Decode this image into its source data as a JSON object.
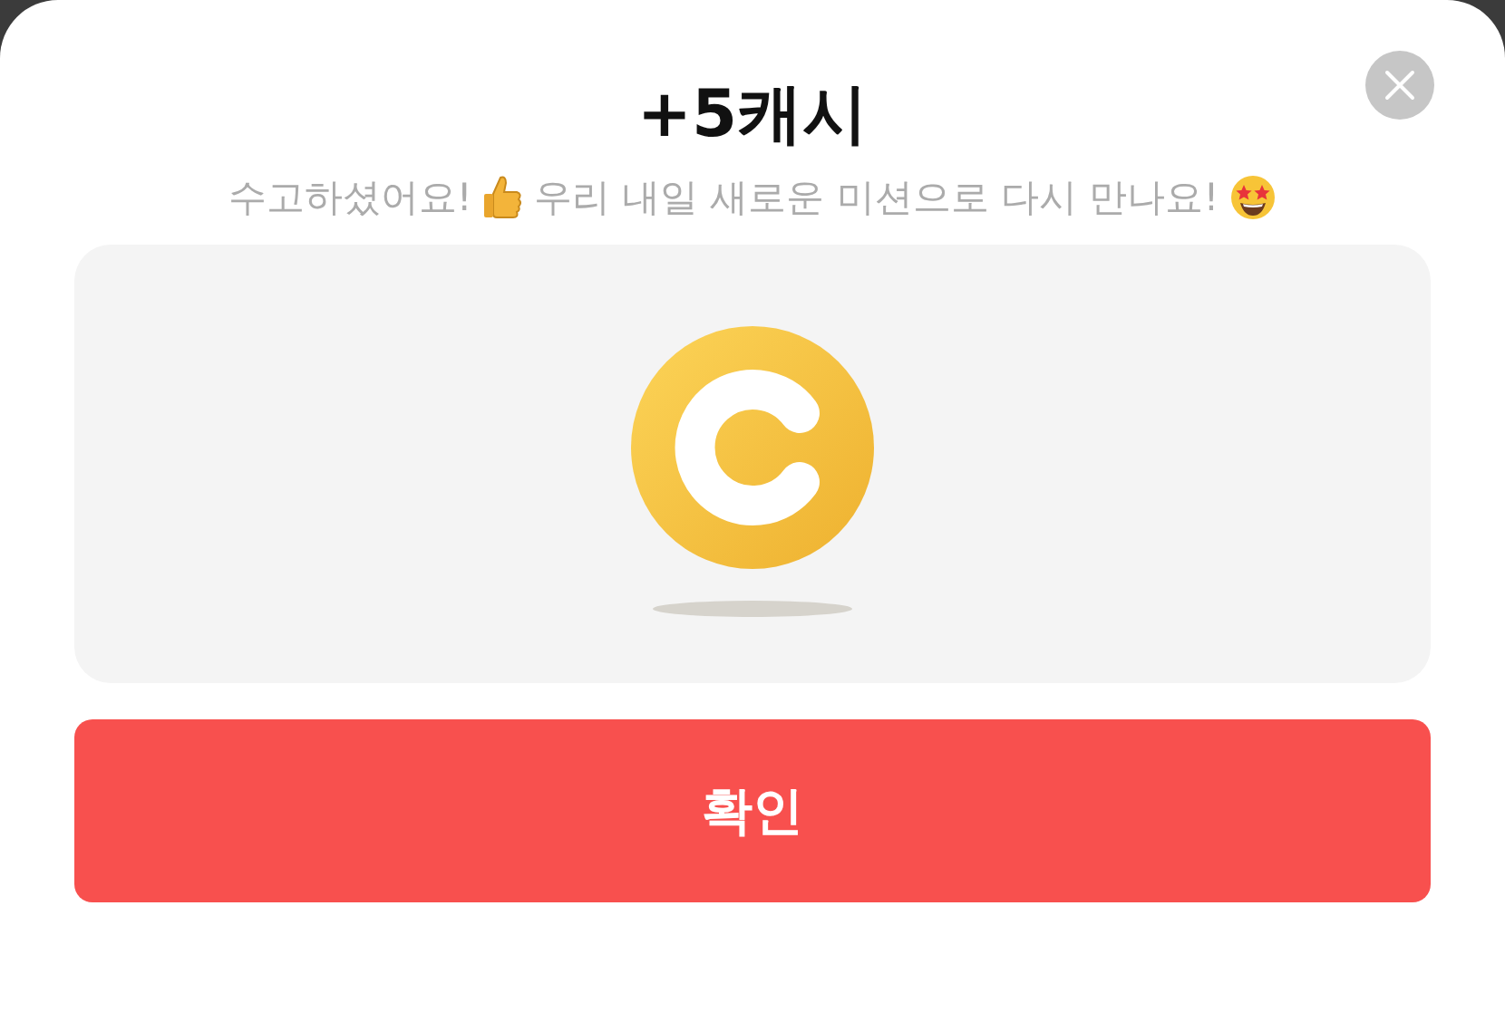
{
  "title": "+5캐시",
  "subtitle": [
    "수고하셨어요!",
    "우리 내일 새로운 미션으로 다시 만나요!"
  ],
  "confirm_button": {
    "label": "확인"
  }
}
